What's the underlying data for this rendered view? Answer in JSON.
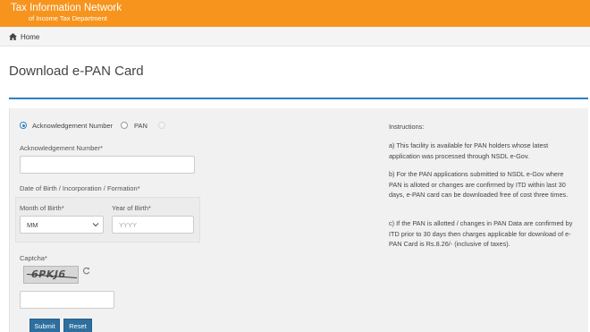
{
  "header": {
    "title": "Tax Information Network",
    "subtitle": "of Income Tax Department"
  },
  "breadcrumb": {
    "home": "Home"
  },
  "page": {
    "title": "Download e-PAN Card"
  },
  "form": {
    "radio_options": [
      {
        "label": "Acknowledgement Number",
        "checked": true
      },
      {
        "label": "PAN",
        "checked": false
      },
      {
        "label": "",
        "checked": false
      }
    ],
    "ack_label": "Acknowledgement Number*",
    "ack_value": "",
    "dob_label": "Date of Birth / Incorporation / Formation*",
    "month_label": "Month of Birth*",
    "month_value": "MM",
    "year_label": "Year of Birth*",
    "year_placeholder": "YYYY",
    "captcha_label": "Captcha*",
    "captcha_text": "6PKJ6",
    "captcha_value": "",
    "submit_label": "Submit",
    "reset_label": "Reset"
  },
  "instructions": {
    "heading": "Instructions:",
    "a": "a) This facility is available for PAN holders whose latest application was processed through NSDL e-Gov.",
    "b": "b) For the PAN applications submitted to NSDL e-Gov where PAN is alloted or changes are confirmed by ITD within last 30 days, e-PAN card can be downloaded free of cost three times.",
    "c": "c) If the PAN is allotted / changes in PAN Data are confirmed by ITD prior to 30 days then charges applicable for download of e-PAN Card is Rs.8.26/- (inclusive of taxes)."
  },
  "colors": {
    "header": "#f7941d",
    "accent": "#2d7fc1",
    "button": "#2d6f9e"
  },
  "icons": [
    "home-icon",
    "chevron-down-icon",
    "refresh-icon"
  ]
}
